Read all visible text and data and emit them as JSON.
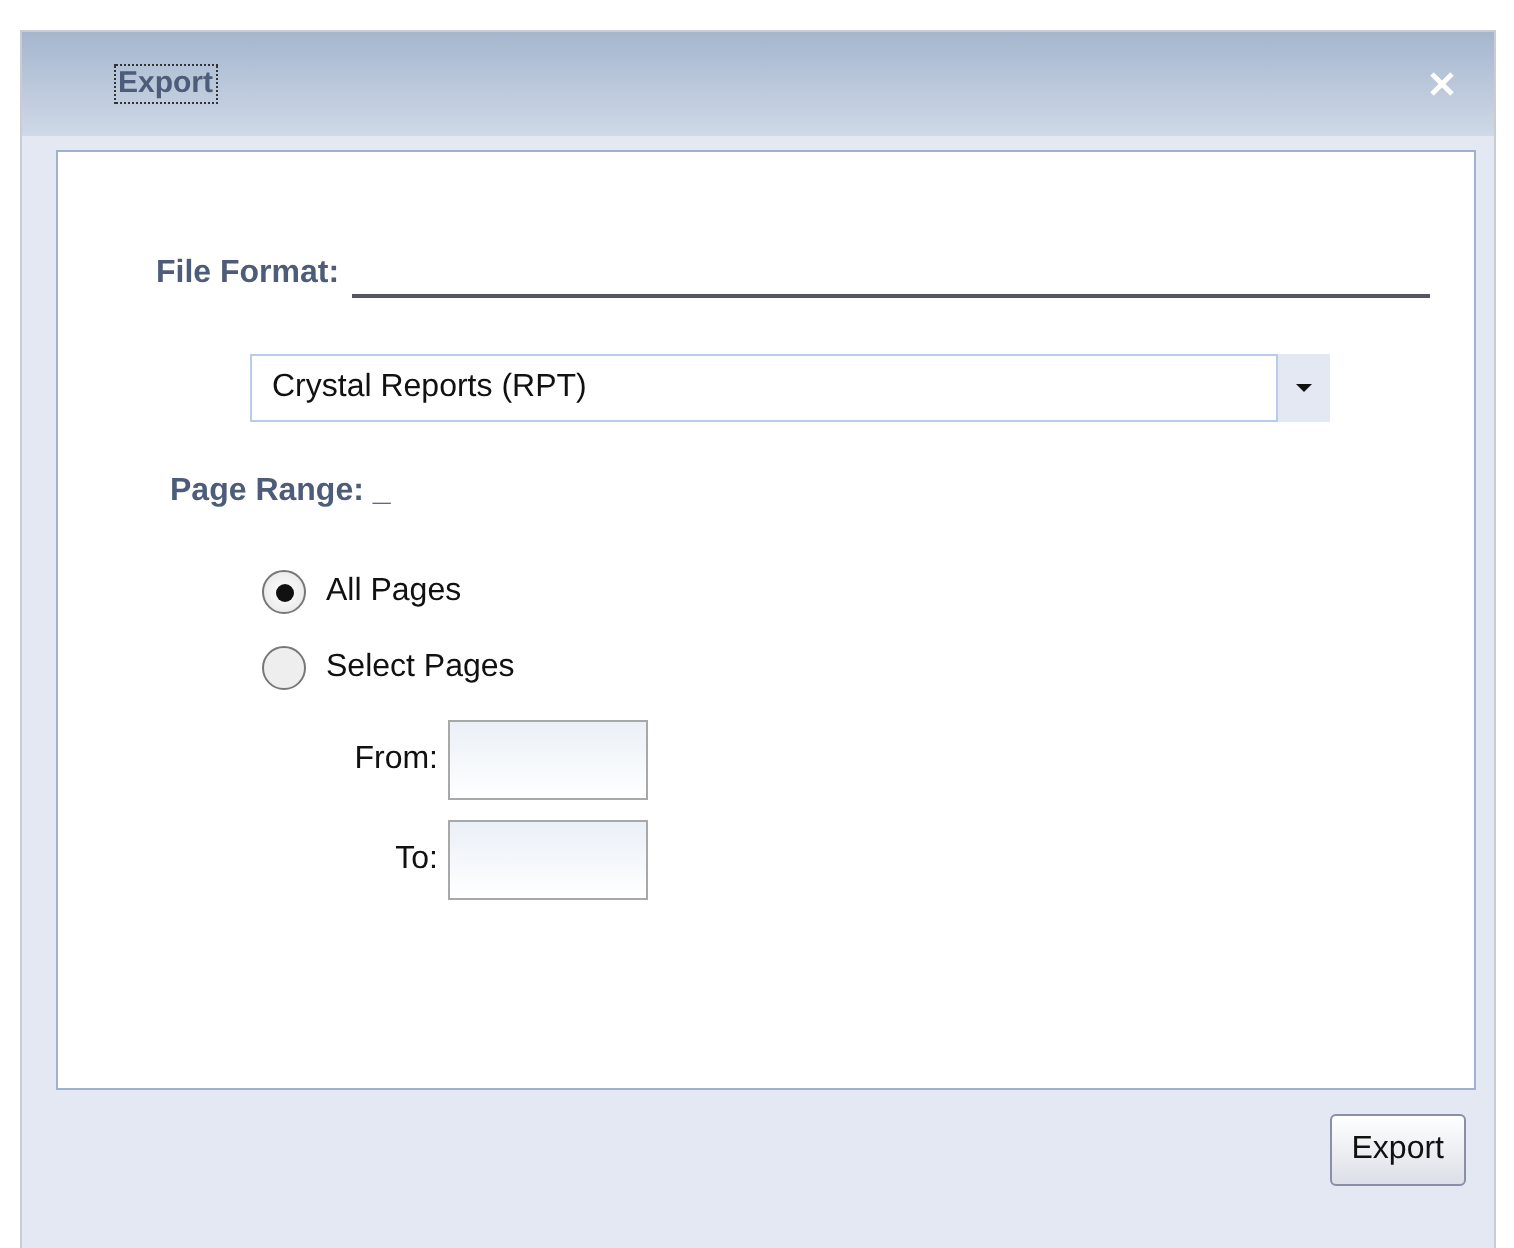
{
  "window": {
    "title": "Export"
  },
  "file_format": {
    "heading": "File Format:",
    "value": "Crystal Reports (RPT)"
  },
  "page_range": {
    "heading": "Page Range: _",
    "options": [
      {
        "label": "All Pages",
        "selected": true
      },
      {
        "label": "Select Pages",
        "selected": false
      }
    ],
    "fields": [
      {
        "label": "From:"
      },
      {
        "label": "To:"
      }
    ]
  },
  "buttons": [
    "Export"
  ]
}
